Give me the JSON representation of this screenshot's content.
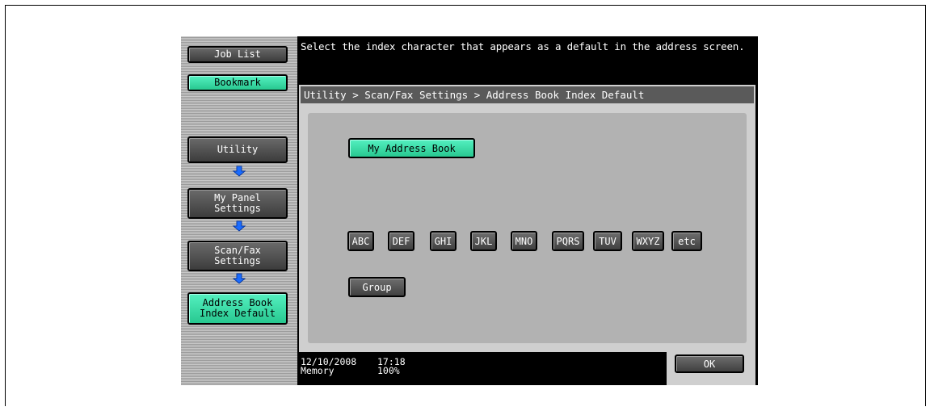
{
  "message": "Select the index character that appears as a default in the address screen.",
  "sidebar": {
    "job_list": "Job List",
    "bookmark": "Bookmark",
    "steps": [
      "Utility",
      "My Panel\nSettings",
      "Scan/Fax\nSettings",
      "Address Book\nIndex Default"
    ]
  },
  "breadcrumb": "Utility > Scan/Fax Settings > Address Book Index Default",
  "my_address_book": "My Address Book",
  "index_keys": [
    "ABC",
    "DEF",
    "GHI",
    "JKL",
    "MNO",
    "PQRS",
    "TUV",
    "WXYZ",
    "etc"
  ],
  "group": "Group",
  "ok": "OK",
  "status": {
    "date": "12/10/2008",
    "time": "17:18",
    "memory_label": "Memory",
    "memory_value": "100%"
  },
  "colors": {
    "selected_green": "#3ce0a8",
    "button_gray": "#555555",
    "panel": "#cfcfcf"
  }
}
